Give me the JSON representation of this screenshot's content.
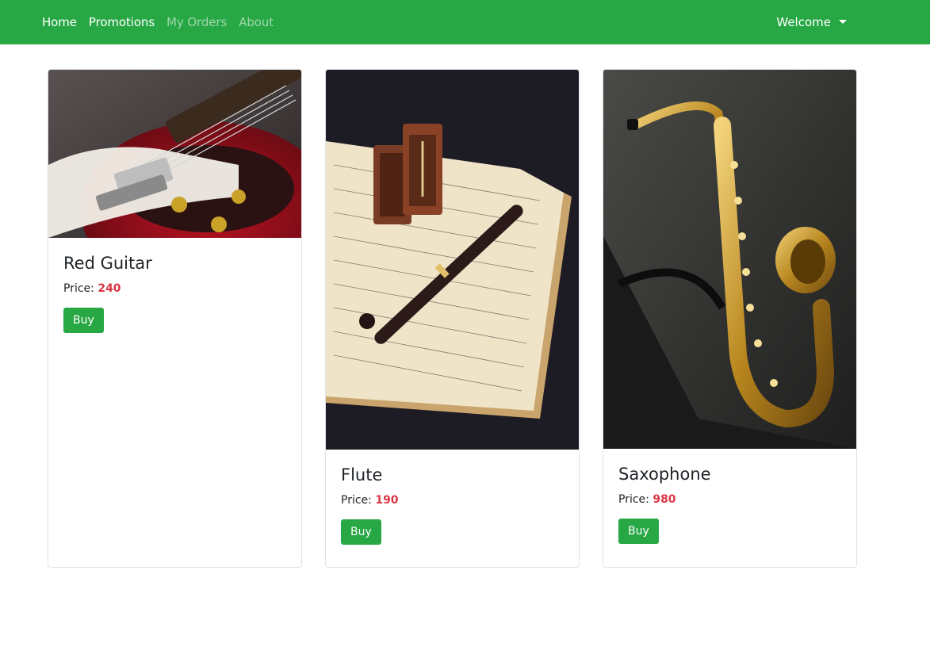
{
  "navbar": {
    "bg_color": "#28a745",
    "links": [
      {
        "label": "Home",
        "state": "active"
      },
      {
        "label": "Promotions",
        "state": "active"
      },
      {
        "label": "My Orders",
        "state": "muted"
      },
      {
        "label": "About",
        "state": "muted"
      }
    ],
    "user_menu": {
      "label": "Welcome",
      "icon": "caret-down-icon"
    }
  },
  "products": [
    {
      "name": "Red Guitar",
      "price_label": "Price:",
      "price": "240",
      "buy_label": "Buy",
      "image": "red-electric-guitar-image"
    },
    {
      "name": "Flute",
      "price_label": "Price:",
      "price": "190",
      "buy_label": "Buy",
      "image": "flute-on-sheet-music-image"
    },
    {
      "name": "Saxophone",
      "price_label": "Price:",
      "price": "980",
      "buy_label": "Buy",
      "image": "saxophone-image"
    }
  ],
  "colors": {
    "accent": "#28a745",
    "price": "#dc3545"
  }
}
